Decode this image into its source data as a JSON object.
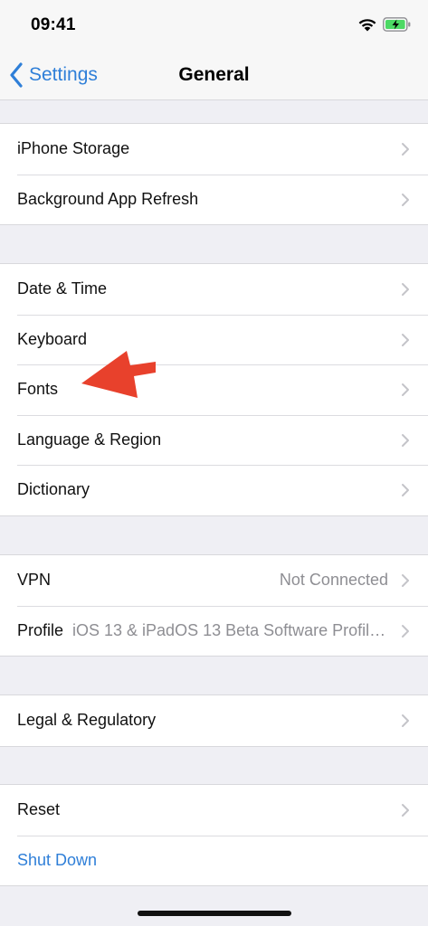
{
  "status_bar": {
    "time": "09:41"
  },
  "nav": {
    "back_label": "Settings",
    "title": "General"
  },
  "groups": [
    {
      "rows": [
        {
          "label": "iPhone Storage"
        },
        {
          "label": "Background App Refresh"
        }
      ]
    },
    {
      "rows": [
        {
          "label": "Date & Time"
        },
        {
          "label": "Keyboard"
        },
        {
          "label": "Fonts"
        },
        {
          "label": "Language & Region"
        },
        {
          "label": "Dictionary"
        }
      ]
    },
    {
      "rows": [
        {
          "label": "VPN",
          "value": "Not Connected"
        },
        {
          "label": "Profile",
          "value": "iOS 13 & iPadOS 13 Beta Software Profile..."
        }
      ]
    },
    {
      "rows": [
        {
          "label": "Legal & Regulatory"
        }
      ]
    },
    {
      "rows": [
        {
          "label": "Reset"
        },
        {
          "label": "Shut Down"
        }
      ]
    }
  ],
  "colors": {
    "accent": "#2f7fd8",
    "annotation_arrow": "#e8412c",
    "background": "#efeff4"
  },
  "icons": [
    "wifi-icon",
    "battery-charging-icon",
    "back-chevron-icon",
    "chevron-right-icon"
  ]
}
